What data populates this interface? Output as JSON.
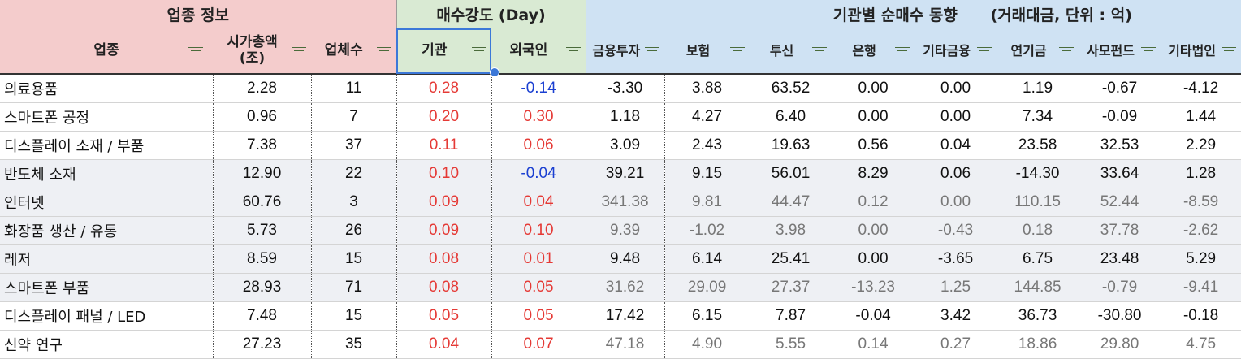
{
  "groups": {
    "industry_info": "업종 정보",
    "buy_strength": "매수강도 (Day)",
    "institution_trend": "기관별 순매수 동향",
    "unit": "(거래대금, 단위 : 억)"
  },
  "columns": [
    {
      "key": "sector",
      "label": "업종"
    },
    {
      "key": "mcap",
      "label": "시가총액",
      "label2": "(조)"
    },
    {
      "key": "count",
      "label": "업체수"
    },
    {
      "key": "inst",
      "label": "기관"
    },
    {
      "key": "foreign",
      "label": "외국인"
    },
    {
      "key": "fin",
      "label": "금융투자"
    },
    {
      "key": "ins",
      "label": "보험"
    },
    {
      "key": "trust",
      "label": "투신"
    },
    {
      "key": "bank",
      "label": "은행"
    },
    {
      "key": "otherfin",
      "label": "기타금융"
    },
    {
      "key": "pension",
      "label": "연기금"
    },
    {
      "key": "pef",
      "label": "사모펀드"
    },
    {
      "key": "othercorp",
      "label": "기타법인"
    }
  ],
  "rows": [
    {
      "sector": "의료용품",
      "mcap": "2.28",
      "count": "11",
      "inst": "0.28",
      "foreign": "-0.14",
      "fin": "-3.30",
      "ins": "3.88",
      "trust": "63.52",
      "bank": "0.00",
      "otherfin": "0.00",
      "pension": "1.19",
      "pef": "-0.67",
      "othercorp": "-4.12",
      "shade": false,
      "dim": false
    },
    {
      "sector": "스마트폰 공정",
      "mcap": "0.96",
      "count": "7",
      "inst": "0.20",
      "foreign": "0.30",
      "fin": "1.18",
      "ins": "4.27",
      "trust": "6.40",
      "bank": "0.00",
      "otherfin": "0.00",
      "pension": "7.34",
      "pef": "-0.09",
      "othercorp": "1.44",
      "shade": false,
      "dim": false
    },
    {
      "sector": "디스플레이 소재 / 부품",
      "mcap": "7.38",
      "count": "37",
      "inst": "0.11",
      "foreign": "0.06",
      "fin": "3.09",
      "ins": "2.43",
      "trust": "19.63",
      "bank": "0.56",
      "otherfin": "0.04",
      "pension": "23.58",
      "pef": "32.53",
      "othercorp": "2.29",
      "shade": false,
      "dim": false
    },
    {
      "sector": "반도체 소재",
      "mcap": "12.90",
      "count": "22",
      "inst": "0.10",
      "foreign": "-0.04",
      "fin": "39.21",
      "ins": "9.15",
      "trust": "56.01",
      "bank": "8.29",
      "otherfin": "0.06",
      "pension": "-14.30",
      "pef": "33.64",
      "othercorp": "1.28",
      "shade": true,
      "dim": false
    },
    {
      "sector": "인터넷",
      "mcap": "60.76",
      "count": "3",
      "inst": "0.09",
      "foreign": "0.04",
      "fin": "341.38",
      "ins": "9.81",
      "trust": "44.47",
      "bank": "0.12",
      "otherfin": "0.00",
      "pension": "110.15",
      "pef": "52.44",
      "othercorp": "-8.59",
      "shade": true,
      "dim": true
    },
    {
      "sector": "화장품 생산 / 유통",
      "mcap": "5.73",
      "count": "26",
      "inst": "0.09",
      "foreign": "0.10",
      "fin": "9.39",
      "ins": "-1.02",
      "trust": "3.98",
      "bank": "0.00",
      "otherfin": "-0.43",
      "pension": "0.18",
      "pef": "37.78",
      "othercorp": "-2.62",
      "shade": true,
      "dim": true
    },
    {
      "sector": "레저",
      "mcap": "8.59",
      "count": "15",
      "inst": "0.08",
      "foreign": "0.01",
      "fin": "9.48",
      "ins": "6.14",
      "trust": "25.41",
      "bank": "0.00",
      "otherfin": "-3.65",
      "pension": "6.75",
      "pef": "23.48",
      "othercorp": "5.29",
      "shade": true,
      "dim": false
    },
    {
      "sector": "스마트폰 부품",
      "mcap": "28.93",
      "count": "71",
      "inst": "0.08",
      "foreign": "0.05",
      "fin": "31.62",
      "ins": "29.09",
      "trust": "27.37",
      "bank": "-13.23",
      "otherfin": "1.25",
      "pension": "144.85",
      "pef": "-0.79",
      "othercorp": "-9.41",
      "shade": true,
      "dim": true
    },
    {
      "sector": "디스플레이 패널 / LED",
      "mcap": "7.48",
      "count": "15",
      "inst": "0.05",
      "foreign": "0.05",
      "fin": "17.42",
      "ins": "6.15",
      "trust": "7.87",
      "bank": "-0.04",
      "otherfin": "3.42",
      "pension": "36.73",
      "pef": "-30.80",
      "othercorp": "-0.18",
      "shade": false,
      "dim": false
    },
    {
      "sector": "신약 연구",
      "mcap": "27.23",
      "count": "35",
      "inst": "0.04",
      "foreign": "0.07",
      "fin": "47.18",
      "ins": "4.90",
      "trust": "5.55",
      "bank": "0.14",
      "otherfin": "0.27",
      "pension": "18.86",
      "pef": "29.80",
      "othercorp": "4.75",
      "shade": false,
      "dim": true
    }
  ],
  "colors": {
    "positive": "#e53935",
    "negative": "#1a3fd1",
    "header_pink": "#f4cccc",
    "header_green": "#d9ead3",
    "header_blue": "#cfe2f3",
    "selection": "#3c78d8"
  },
  "icons": {
    "filter": "filter-icon"
  }
}
